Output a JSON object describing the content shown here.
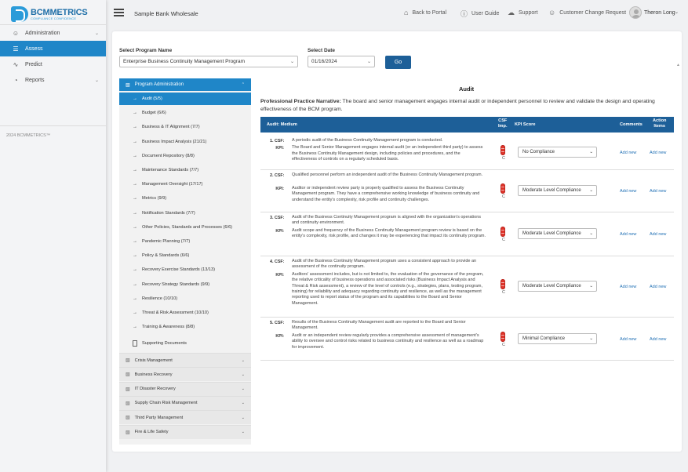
{
  "brand": {
    "name": "BCMMETRICS",
    "tagline": "COMPLIANCE CONFIDENCE"
  },
  "sidebar": {
    "items": [
      {
        "label": "Administration",
        "icon": "users-icon",
        "has_chevron": true
      },
      {
        "label": "Assess",
        "icon": "list-icon",
        "active": true
      },
      {
        "label": "Predict",
        "icon": "pulse-icon"
      },
      {
        "label": "Reports",
        "icon": "pie-chart-icon",
        "has_chevron": true
      }
    ],
    "copyright": "2024 BCMMETRICS™"
  },
  "header": {
    "bank_name": "Sample Bank Wholesale",
    "links": [
      {
        "label": "Back to Portal",
        "icon": "home-icon"
      },
      {
        "label": "User Guide",
        "icon": "help-circle-icon"
      },
      {
        "label": "Support",
        "icon": "cloud-icon"
      },
      {
        "label": "Customer Change Request",
        "icon": "users-icon"
      }
    ],
    "user": "Theron Long"
  },
  "filters": {
    "program_label": "Select Program Name",
    "program_value": "Enterprise Business Continuity Management Program",
    "date_label": "Select Date",
    "date_value": "01/16/2024",
    "go_label": "Go"
  },
  "tree": {
    "program_admin": "Program Administration",
    "children": [
      "Audit  (5/5)",
      "Budget  (6/6)",
      "Business & IT Alignment  (7/7)",
      "Business Impact Analysis  (21/21)",
      "Document Repository  (8/8)",
      "Maintenance Standards  (7/7)",
      "Management Oversight  (17/17)",
      "Metrics  (9/9)",
      "Notification Standards  (7/7)",
      "Other Policies, Standards and Processes  (6/6)",
      "Pandemic Planning  (7/7)",
      "Policy & Standards  (6/6)",
      "Recovery Exercise Standards  (13/13)",
      "Recovery Strategy Standards  (9/9)",
      "Resilience  (10/10)",
      "Threat & Risk Assessment  (10/10)",
      "Training & Awareness  (8/8)"
    ],
    "supporting_docs": "Supporting Documents",
    "sections": [
      "Crisis Management",
      "Business Recovery",
      "IT Disaster Recovery",
      "Supply Chain Risk Management",
      "Third Party Management",
      "Fire & Life Safety"
    ]
  },
  "audit": {
    "title": "Audit",
    "narrative_label": "Professional Practice Narrative:",
    "narrative_text": "The board and senior management engages internal audit or independent personnel to review and validate the design and operating effectiveness of the BCM program.",
    "table_headers": {
      "audit": "Audit: Medium",
      "csf_imp_1": "CSF",
      "csf_imp_2": "Imp.",
      "kpi_score": "KPI Score",
      "comments": "Comments",
      "action_1": "Action",
      "action_2": "Items"
    },
    "csf_label": "CSF:",
    "kpi_label": "KPI:",
    "add_new": "Add new",
    "badge_letter": "C",
    "rows": [
      {
        "num": "1.",
        "csf": "A periodic audit of the Business Continuity Management program is conducted.",
        "kpi": "The Board and Senior Management engages internal audit (or an independent third party) to assess the Business Continuity Management design, including policies and procedures, and the effectiveness of controls on a regularly scheduled basis.",
        "score": "No Compliance"
      },
      {
        "num": "2.",
        "csf": "Qualified personnel perform an independent audit of the Business Continuity Management program.",
        "kpi": "Auditor or independent review party is properly qualified to assess the Business Continuity Management program. They have a comprehensive working knowledge of business continuity and understand the entity's complexity, risk profile and continuity challenges.",
        "score": "Moderate Level Compliance"
      },
      {
        "num": "3.",
        "csf": "Audit of the Business Continuity Management program is aligned with the organization's operations and continuity environment.",
        "kpi": "Audit scope and frequency of the Business Continuity Management program review is based on the entity's complexity, risk profile, and changes it may be experiencing that impact its continuity program.",
        "score": "Moderate Level Compliance"
      },
      {
        "num": "4.",
        "csf": "Audit of the Business Continuity Management program uses a consistent approach to provide an assessment of the continuity program.",
        "kpi": "Auditors' assessment includes, but is not limited to, the evaluation of the governance of the program, the relative criticality of business operations and associated risks (Business Impact Analysis and Threat & Risk assessment), a review of the level of controls (e.g., strategies, plans, testing program, training) for reliability and adequacy regarding continuity and resilience, as well as the management reporting used to report status of the program and its capabilities to the Board and Senior Management.",
        "score": "Moderate Level Compliance"
      },
      {
        "num": "5.",
        "csf": "Results of the Business Continuity Management audit are reported to the Board and Senior Management.",
        "kpi": "Audit or an independent review regularly provides a comprehensive assessment of management's ability to oversee and control risks related to business continuity and resilience as well as a roadmap for improvement.",
        "score": "Minimal Compliance"
      }
    ]
  },
  "colors": {
    "accent": "#1f86c8",
    "header_bar": "#1d5f98",
    "badge_red": "#e0352b"
  }
}
